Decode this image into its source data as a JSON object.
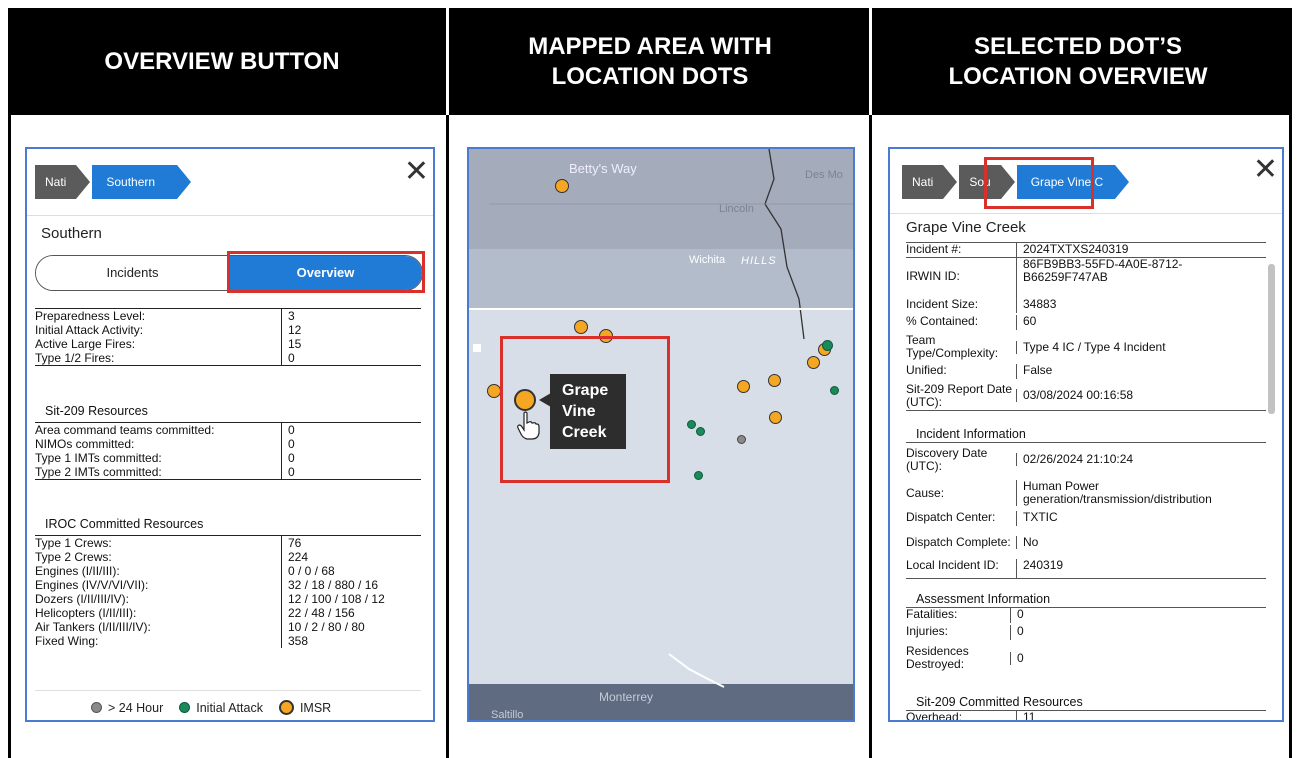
{
  "headers": {
    "col1": "OVERVIEW BUTTON",
    "col2_line1": "MAPPED AREA WITH",
    "col2_line2": "LOCATION DOTS",
    "col3_line1": "SELECTED DOT’S",
    "col3_line2": "LOCATION OVERVIEW"
  },
  "overview_panel": {
    "breadcrumb": [
      "Nati",
      "Southern"
    ],
    "close_glyph": "✕",
    "title": "Southern",
    "tabs": {
      "incidents": "Incidents",
      "overview": "Overview"
    },
    "preparedness": [
      {
        "label": "Preparedness Level:",
        "value": "3"
      },
      {
        "label": "Initial Attack Activity:",
        "value": "12"
      },
      {
        "label": "Active Large Fires:",
        "value": "15"
      },
      {
        "label": "Type 1/2 Fires:",
        "value": "0"
      }
    ],
    "sit209_heading": "Sit-209 Resources",
    "sit209": [
      {
        "label": "Area command teams committed:",
        "value": "0"
      },
      {
        "label": "NIMOs committed:",
        "value": "0"
      },
      {
        "label": "Type 1 IMTs committed:",
        "value": "0"
      },
      {
        "label": "Type 2 IMTs committed:",
        "value": "0"
      }
    ],
    "iroc_heading": "IROC Committed Resources",
    "iroc": [
      {
        "label": "Type 1 Crews:",
        "value": "76"
      },
      {
        "label": "Type 2 Crews:",
        "value": "224"
      },
      {
        "label": "Engines (I/II/III):",
        "value": "0 / 0 / 68"
      },
      {
        "label": "Engines (IV/V/VI/VII):",
        "value": "32 / 18 / 880 / 16"
      },
      {
        "label": "Dozers (I/II/III/IV):",
        "value": "12 / 100 / 108 / 12"
      },
      {
        "label": "Helicopters (I/II/III):",
        "value": "22 / 48 / 156"
      },
      {
        "label": "Air Tankers (I/II/III/IV):",
        "value": "10 / 2 / 80 / 80"
      },
      {
        "label": "Fixed Wing:",
        "value": "358"
      }
    ],
    "legend": [
      {
        "label": "> 24 Hour",
        "color": "#8a8a8a"
      },
      {
        "label": "Initial Attack",
        "color": "#1a8a5a"
      },
      {
        "label": "IMSR",
        "color": "#f5a623"
      }
    ]
  },
  "map_panel": {
    "labels": {
      "bettys_way": "Betty's Way",
      "des_moines": "Des Mo",
      "lincoln": "Lincoln",
      "wichita": "Wichita",
      "hills": "HILLS",
      "monterrey": "Monterrey",
      "saltillo": "Saltillo"
    },
    "tooltip": {
      "line1": "Grape",
      "line2": "Vine",
      "line3": "Creek"
    },
    "colors": {
      "imsr": "#f5a623",
      "initial_attack": "#1a8a5a",
      "older": "#8a8a8a"
    }
  },
  "location_panel": {
    "breadcrumb": [
      "Nati",
      "Sou",
      "Grape Vine C"
    ],
    "close_glyph": "✕",
    "title": "Grape Vine Creek",
    "incident": [
      {
        "label": "Incident #:",
        "value": "2024TXTXS240319"
      },
      {
        "label": "IRWIN ID:",
        "value": "86FB9BB3-55FD-4A0E-8712-B66259F747AB"
      },
      {
        "label": "Incident Size:",
        "value": "34883"
      },
      {
        "label": "% Contained:",
        "value": "60"
      },
      {
        "label": "Team Type/Complexity:",
        "value": "Type 4 IC / Type 4 Incident"
      },
      {
        "label": "Unified:",
        "value": "False"
      },
      {
        "label": "Sit-209 Report Date (UTC):",
        "value": "03/08/2024 00:16:58"
      }
    ],
    "info_heading": "Incident Information",
    "info": [
      {
        "label": "Discovery Date (UTC):",
        "value": "02/26/2024 21:10:24"
      },
      {
        "label": "Cause:",
        "value": "Human Power generation/transmission/distribution"
      },
      {
        "label": "Dispatch Center:",
        "value": "TXTIC"
      },
      {
        "label": "Dispatch Complete:",
        "value": "No"
      },
      {
        "label": "Local Incident ID:",
        "value": "240319"
      }
    ],
    "assessment_heading": "Assessment Information",
    "assessment": [
      {
        "label": "Fatalities:",
        "value": "0"
      },
      {
        "label": "Injuries:",
        "value": "0"
      },
      {
        "label": "Residences Destroyed:",
        "value": "0"
      }
    ],
    "committed_heading": "Sit-209 Committed Resources",
    "committed": [
      {
        "label": "Overhead:",
        "value": "11"
      }
    ]
  }
}
